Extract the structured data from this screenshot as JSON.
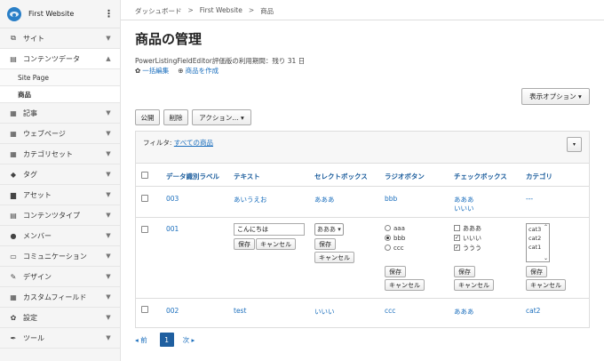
{
  "sidebar": {
    "site_name": "First Website",
    "kebab": "⋮",
    "items": [
      {
        "icon": "⧉",
        "icon_name": "site-icon",
        "label": "サイト"
      },
      {
        "icon": "▤",
        "icon_name": "content-data-icon",
        "label": "コンテンツデータ",
        "open": true
      },
      {
        "icon": "▦",
        "icon_name": "article-icon",
        "label": "記事"
      },
      {
        "icon": "▦",
        "icon_name": "webpage-icon",
        "label": "ウェブページ"
      },
      {
        "icon": "▦",
        "icon_name": "category-set-icon",
        "label": "カテゴリセット"
      },
      {
        "icon": "◆",
        "icon_name": "tag-icon",
        "label": "タグ"
      },
      {
        "icon": "▆",
        "icon_name": "asset-icon",
        "label": "アセット"
      },
      {
        "icon": "▤",
        "icon_name": "content-type-icon",
        "label": "コンテンツタイプ"
      },
      {
        "icon": "●",
        "icon_name": "member-icon",
        "label": "メンバー"
      },
      {
        "icon": "▭",
        "icon_name": "communication-icon",
        "label": "コミュニケーション"
      },
      {
        "icon": "✎",
        "icon_name": "design-icon",
        "label": "デザイン"
      },
      {
        "icon": "▦",
        "icon_name": "custom-field-icon",
        "label": "カスタムフィールド"
      },
      {
        "icon": "✿",
        "icon_name": "settings-icon",
        "label": "設定"
      },
      {
        "icon": "✒",
        "icon_name": "tools-icon",
        "label": "ツール"
      }
    ],
    "sub_items": [
      "Site Page",
      "商品"
    ],
    "chev_down": "▼",
    "chev_up": "▲"
  },
  "breadcrumb": {
    "items": [
      "ダッシュボード",
      "First Website",
      "商品"
    ],
    "sep": ">"
  },
  "page_title": "商品の管理",
  "trial_notice": "PowerListingFieldEditor評価版の利用期間：残り 31 日",
  "actions": {
    "bulk_edit_icon": "✿",
    "bulk_edit": "一括編集",
    "create_icon": "⊕",
    "create": "商品を作成"
  },
  "display_options": "表示オプション ▾",
  "bulk": {
    "publish": "公開",
    "delete": "削除",
    "action": "アクション... ▾"
  },
  "filter": {
    "label": "フィルタ:",
    "value": "すべての商品",
    "toggle": "▾"
  },
  "table": {
    "headers": [
      "データ識別ラベル",
      "テキスト",
      "セレクトボックス",
      "ラジオボタン",
      "チェックボックス",
      "カテゴリ"
    ],
    "row1": {
      "id": "003",
      "text": "あいうえお",
      "select": "あああ",
      "radio": "bbb",
      "check": [
        "あああ",
        "いいい"
      ],
      "category": "---"
    },
    "row2": {
      "id": "001",
      "text_value": "こんにちは",
      "select_value": "あああ ▾",
      "radio_options": [
        "aaa",
        "bbb",
        "ccc"
      ],
      "check_options": [
        "あああ",
        "いいい",
        "ううう"
      ],
      "check_mark": "✓",
      "categories": [
        "cat3",
        "cat2",
        "cat1"
      ],
      "scroll_up": "⌃",
      "scroll_down": "⌄",
      "save": "保存",
      "cancel": "キャンセル"
    },
    "row3": {
      "id": "002",
      "text": "test",
      "select": "いいい",
      "radio": "ccc",
      "check": "あああ",
      "category": "cat2"
    }
  },
  "pager": {
    "prev": "◂ 前",
    "current": "1",
    "next": "次 ▸"
  }
}
